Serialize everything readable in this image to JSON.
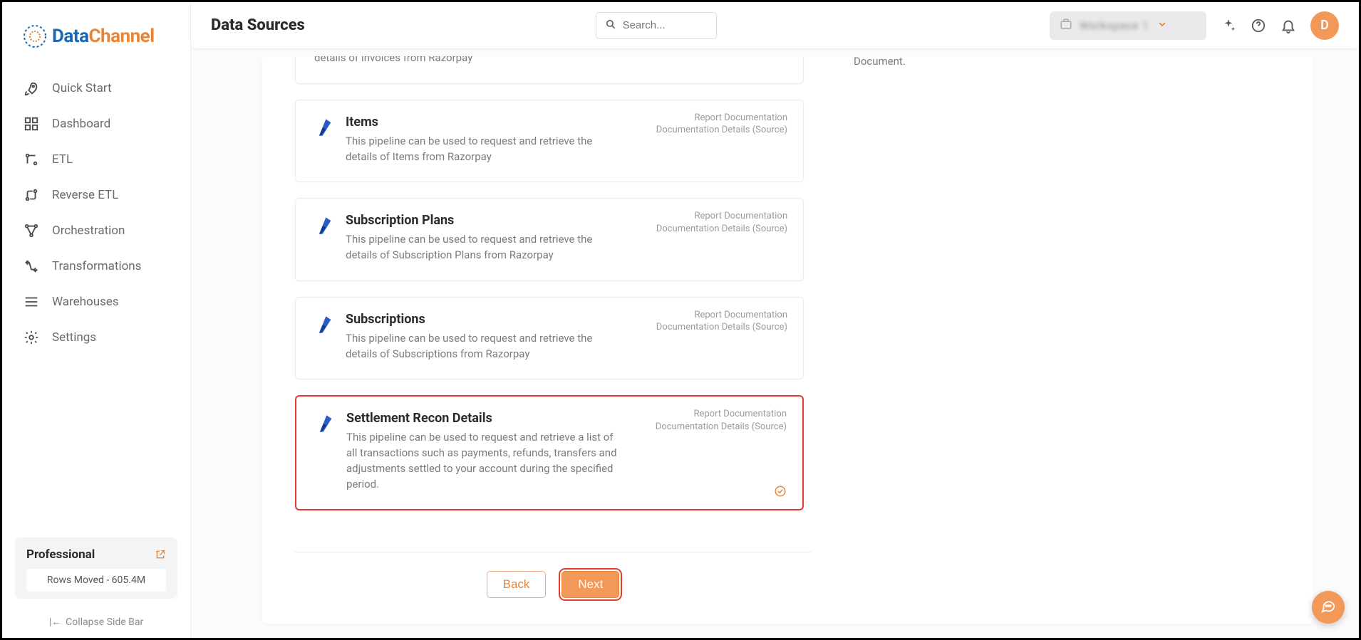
{
  "brand": {
    "first": "Data",
    "second": "Channel"
  },
  "sidebar": {
    "items": [
      {
        "label": "Quick Start"
      },
      {
        "label": "Dashboard"
      },
      {
        "label": "ETL"
      },
      {
        "label": "Reverse ETL"
      },
      {
        "label": "Orchestration"
      },
      {
        "label": "Transformations"
      },
      {
        "label": "Warehouses"
      },
      {
        "label": "Settings"
      }
    ],
    "plan": {
      "title": "Professional",
      "rows": "Rows Moved - 605.4M"
    },
    "collapse": "Collapse Side Bar"
  },
  "topbar": {
    "title": "Data Sources",
    "search_placeholder": "Search...",
    "workspace": "Workspace 1",
    "avatar_initial": "D"
  },
  "pipelines": {
    "truncated_desc": "details of Invoices from Razorpay",
    "link1": "Report Documentation",
    "link2": "Documentation Details (Source)",
    "items": [
      {
        "title": "Items",
        "desc": "This pipeline can be used to request and retrieve the details of Items from Razorpay"
      },
      {
        "title": "Subscription Plans",
        "desc": "This pipeline can be used to request and retrieve the details of Subscription Plans from Razorpay"
      },
      {
        "title": "Subscriptions",
        "desc": "This pipeline can be used to request and retrieve the details of Subscriptions from Razorpay"
      },
      {
        "title": "Settlement Recon Details",
        "desc": "This pipeline can be used to request and retrieve a list of all transactions such as payments, refunds, transfers and adjustments settled to your account during the specified period."
      }
    ]
  },
  "actions": {
    "back": "Back",
    "next": "Next"
  },
  "side_note": "Document."
}
